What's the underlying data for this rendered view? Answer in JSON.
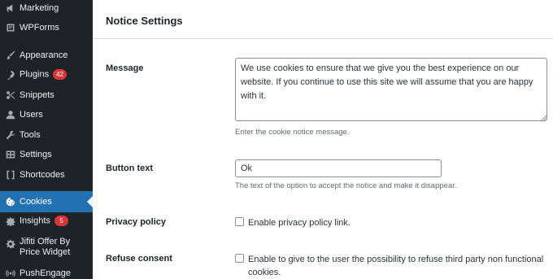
{
  "sidebar": {
    "items": [
      {
        "label": "Marketing",
        "icon": "megaphone-icon"
      },
      {
        "label": "WPForms",
        "icon": "wpforms-icon"
      },
      {
        "label": "Appearance",
        "icon": "paintbrush-icon"
      },
      {
        "label": "Plugins",
        "icon": "plug-icon",
        "badge": "42"
      },
      {
        "label": "Snippets",
        "icon": "scissors-icon"
      },
      {
        "label": "Users",
        "icon": "user-icon"
      },
      {
        "label": "Tools",
        "icon": "wrench-icon"
      },
      {
        "label": "Settings",
        "icon": "settings-icon"
      },
      {
        "label": "Shortcodes",
        "icon": "brackets-icon"
      },
      {
        "label": "Cookies",
        "icon": "cookie-icon",
        "active": true
      },
      {
        "label": "Insights",
        "icon": "insights-icon",
        "badge": "5"
      },
      {
        "label": "Jifiti Offer By Price Widget",
        "icon": "gear-icon"
      },
      {
        "label": "PushEngage",
        "icon": "broadcast-icon"
      }
    ],
    "active_color": "#2271b1",
    "badge_color": "#d63638"
  },
  "panel": {
    "title": "Notice Settings",
    "message": {
      "label": "Message",
      "value": "We use cookies to ensure that we give you the best experience on our website. If you continue to use this site we will assume that you are happy with it.",
      "description": "Enter the cookie notice message."
    },
    "button_text": {
      "label": "Button text",
      "value": "Ok",
      "description": "The text of the option to accept the notice and make it disappear."
    },
    "privacy_policy": {
      "label": "Privacy policy",
      "checkbox_label": "Enable privacy policy link.",
      "checked": false
    },
    "refuse_consent": {
      "label": "Refuse consent",
      "checkbox_label_line1": "Enable to give to the user the possibility to refuse third party non functional",
      "checkbox_label_line2": "cookies.",
      "checked": false
    }
  }
}
